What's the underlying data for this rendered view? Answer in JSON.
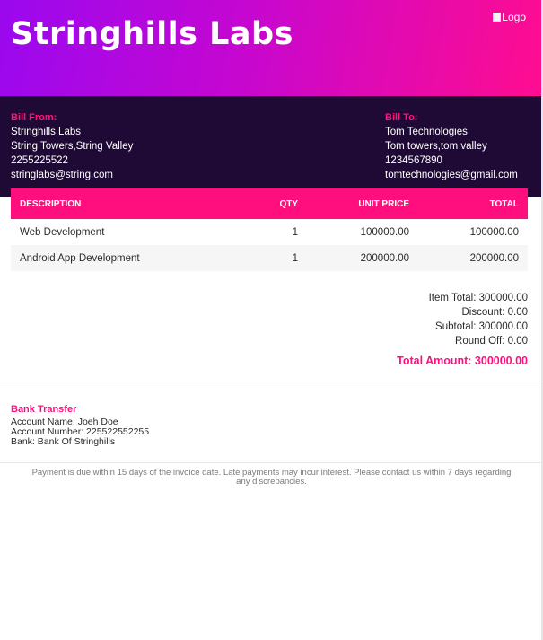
{
  "header": {
    "company_name": "Stringhills Labs",
    "logo_alt": "Logo"
  },
  "bill_from": {
    "heading": "Bill From:",
    "name": "Stringhills Labs",
    "address": "String Towers,String Valley",
    "phone": "2255225522",
    "email": "stringlabs@string.com"
  },
  "bill_to": {
    "heading": "Bill To:",
    "name": "Tom Technologies",
    "address": "Tom towers,tom valley",
    "phone": "1234567890",
    "email": "tomtechnologies@gmail.com"
  },
  "table": {
    "headers": {
      "description": "DESCRIPTION",
      "qty": "QTY",
      "unit_price": "UNIT PRICE",
      "total": "TOTAL"
    },
    "rows": [
      {
        "description": "Web Development",
        "qty": "1",
        "unit_price": "100000.00",
        "total": "100000.00"
      },
      {
        "description": "Android App Development",
        "qty": "1",
        "unit_price": "200000.00",
        "total": "200000.00"
      }
    ]
  },
  "totals": {
    "item_total": "Item Total: 300000.00",
    "discount": "Discount: 0.00",
    "subtotal": "Subtotal: 300000.00",
    "round_off": "Round Off: 0.00",
    "total_amount": "Total Amount: 300000.00"
  },
  "bank": {
    "heading": "Bank Transfer",
    "account_name": "Account Name: Joeh Doe",
    "account_number": "Account Number: 225522552255",
    "bank_name": "Bank: Bank Of Stringhills"
  },
  "footer_note": "Payment is due within 15 days of the invoice date. Late payments may incur interest. Please contact us within 7 days regarding any discrepancies.",
  "colors": {
    "accent": "#ff0f7d",
    "dark": "#1f0a35",
    "gradient_start": "#9a08ef",
    "gradient_end": "#ff0d8f"
  }
}
